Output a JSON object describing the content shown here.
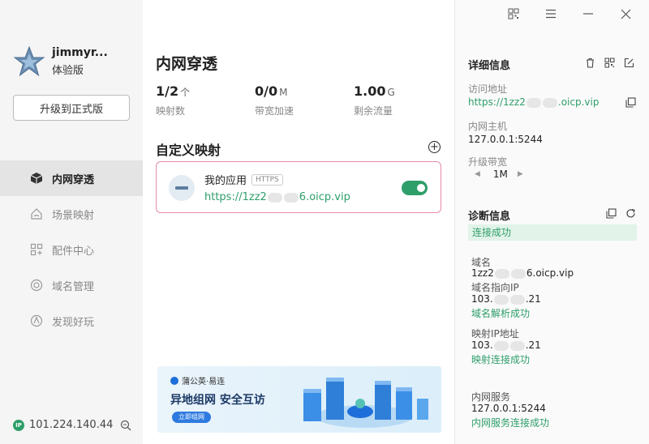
{
  "window": {
    "controls": [
      "qr-code",
      "menu",
      "minimize",
      "close"
    ]
  },
  "sidebar": {
    "username": "jimmyr...",
    "plan": "体验版",
    "upgrade_label": "升级到正式版",
    "items": [
      {
        "label": "内网穿透",
        "icon": "cube-icon",
        "active": true
      },
      {
        "label": "场景映射",
        "icon": "home-scene-icon",
        "active": false
      },
      {
        "label": "配件中心",
        "icon": "grid-plus-icon",
        "active": false
      },
      {
        "label": "域名管理",
        "icon": "globe-icon",
        "active": false
      },
      {
        "label": "发现好玩",
        "icon": "compass-icon",
        "active": false
      }
    ],
    "ip_badge": "IP",
    "ip": "101.224.140.44"
  },
  "main": {
    "title": "内网穿透",
    "stats": [
      {
        "value": "1/2",
        "unit": "个",
        "label": "映射数"
      },
      {
        "value": "0/0",
        "unit": "M",
        "label": "带宽加速"
      },
      {
        "value": "1.00",
        "unit": "G",
        "label": "剩余流量"
      }
    ],
    "section_title": "自定义映射",
    "mapping": {
      "name": "我的应用",
      "protocol": "HTTPS",
      "url_prefix": "https://1zz2",
      "url_suffix": "6.oicp.vip",
      "enabled": true
    },
    "banner": {
      "brand": "蒲公英·易连",
      "title": "异地组网  安全互访",
      "button": "立即组网"
    }
  },
  "detail": {
    "title": "详细信息",
    "access_label": "访问地址",
    "access_prefix": "https://1zz2",
    "access_suffix": ".oicp.vip",
    "host_label": "内网主机",
    "host_value": "127.0.0.1:5244",
    "bandwidth_label": "升级带宽",
    "bandwidth_value": "1M",
    "diag_title": "诊断信息",
    "diag_status": "连接成功",
    "domain_label": "域名",
    "domain_prefix": "1zz2",
    "domain_suffix": "6.oicp.vip",
    "domain_ip_label": "域名指向IP",
    "domain_ip_prefix": "103.",
    "domain_ip_suffix": ".21",
    "domain_ok": "域名解析成功",
    "mapped_ip_label": "映射IP地址",
    "mapped_ip_prefix": "103.",
    "mapped_ip_suffix": ".21",
    "mapped_ok": "映射连接成功",
    "service_label": "内网服务",
    "service_value": "127.0.0.1:5244",
    "service_ok": "内网服务连接成功"
  },
  "colors": {
    "accent": "#2e9e6a",
    "card_border": "#e58ca6",
    "active_nav": "#e4e4e4"
  }
}
